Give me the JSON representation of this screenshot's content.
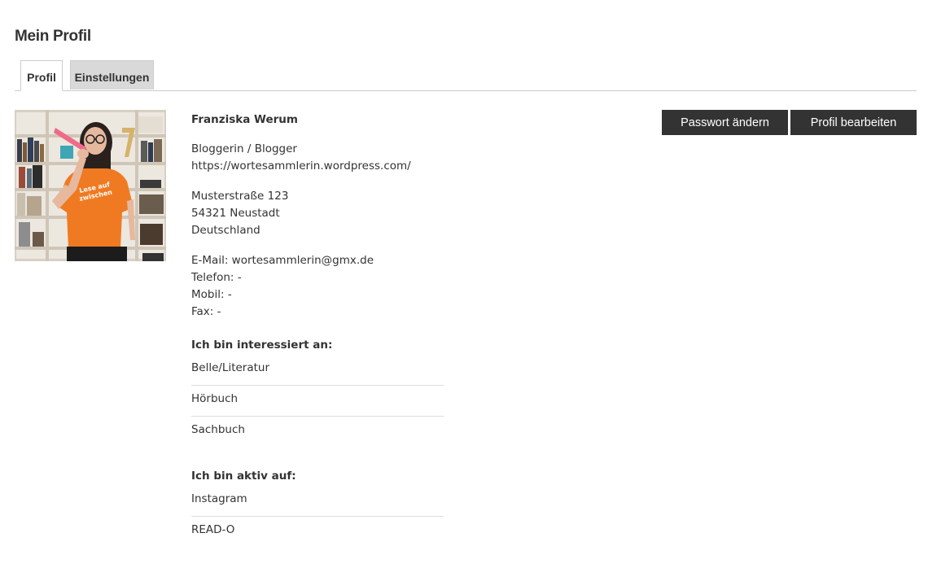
{
  "page": {
    "title": "Mein Profil"
  },
  "tabs": [
    {
      "label": "Profil",
      "active": true
    },
    {
      "label": "Einstellungen",
      "active": false
    }
  ],
  "profile": {
    "name": "Franziska Werum",
    "role": "Bloggerin / Blogger",
    "website": "https://wortesammlerin.wordpress.com/",
    "address": {
      "street": "Musterstraße 123",
      "city": "54321 Neustadt",
      "country": "Deutschland"
    },
    "contact": {
      "email": "E-Mail: wortesammlerin@gmx.de",
      "phone": "Telefon: -",
      "mobile": "Mobil: -",
      "fax": "Fax: -"
    }
  },
  "interests": {
    "heading": "Ich bin interessiert an:",
    "items": [
      "Belle/Literatur",
      "Hörbuch",
      "Sachbuch"
    ]
  },
  "active_on": {
    "heading": "Ich bin aktiv auf:",
    "items": [
      "Instagram",
      "READ-O"
    ]
  },
  "actions": {
    "change_password": "Passwort ändern",
    "edit_profile": "Profil bearbeiten"
  },
  "colors": {
    "button_bg": "#333333",
    "button_text": "#ffffff",
    "tab_inactive_bg": "#d9d9d9",
    "shirt": "#f07a22"
  }
}
